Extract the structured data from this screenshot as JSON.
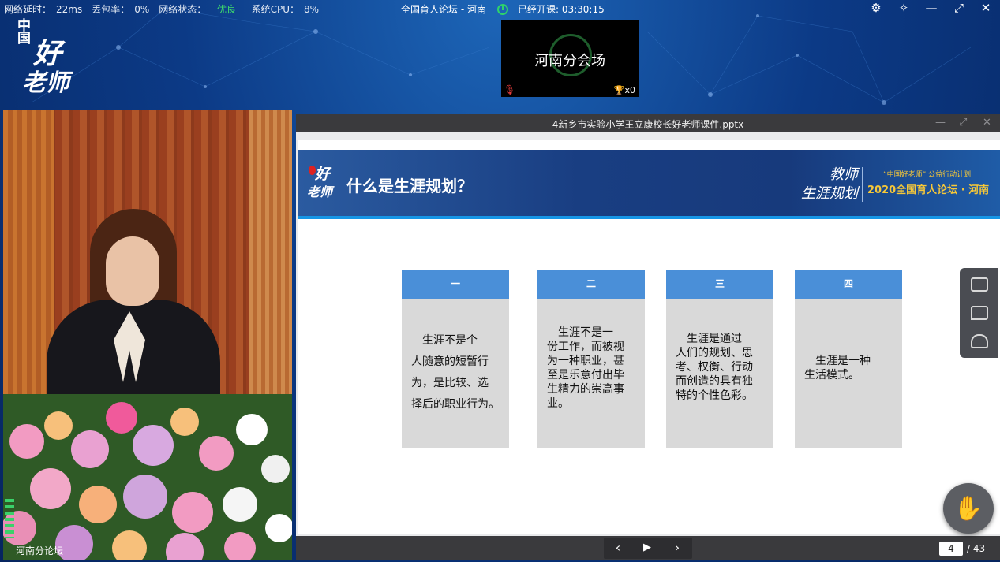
{
  "status": {
    "latency_label": "网络延时：",
    "latency_value": "22ms",
    "loss_label": "丢包率：",
    "loss_value": "0%",
    "net_label": "网络状态：",
    "net_value": "优良",
    "cpu_label": "系统CPU：",
    "cpu_value": "8%"
  },
  "header": {
    "title": "全国育人论坛 - 河南",
    "elapsed": "已经开课: 03:30:15"
  },
  "window_controls": [
    "⚙",
    "✧",
    "—",
    "⤢",
    "✕"
  ],
  "logo": {
    "line1": "中国",
    "line2": "好",
    "line3": "老师"
  },
  "venue": {
    "name": "河南分会场",
    "trophy_count": "x0"
  },
  "video": {
    "caption": "河南分论坛"
  },
  "ppt": {
    "filename": "4新乡市实验小学王立康校长好老师课件.pptx",
    "slide": {
      "logo_a": "好",
      "logo_b": "老师",
      "heading": "什么是生涯规划？",
      "brand_line1": "教师",
      "brand_line2": "生涯规划",
      "brand_sub": "“中国好老师” 公益行动计划",
      "brand_forum": "2020全国育人论坛 · 河南",
      "cards": [
        {
          "num": "一",
          "lines": [
            "　生涯不是个",
            "人随意的短暂行",
            "为，是比较、选",
            "择后的职业行为。"
          ]
        },
        {
          "num": "二",
          "lines": [
            "　生涯不是一",
            "份工作，而被视",
            "为一种职业，甚",
            "至是乐意付出毕",
            "生精力的崇高事",
            "业。"
          ]
        },
        {
          "num": "三",
          "lines": [
            "　生涯是通过",
            "人们的规划、思",
            "考、权衡、行动",
            "而创造的具有独",
            "特的个性色彩。"
          ]
        },
        {
          "num": "四",
          "lines": [
            "　生涯是一种",
            "生活模式。"
          ]
        }
      ]
    },
    "nav": {
      "prev": "‹",
      "play": "▶",
      "next": "›",
      "current_page": "4",
      "total": "/ 43"
    }
  },
  "colors": {
    "card_header": "#4a8fd8",
    "banner": "#193e82",
    "good_status": "#3fe06b"
  },
  "icons": [
    "settings-icon",
    "pin-icon",
    "minimize-icon",
    "maximize-icon",
    "close-icon",
    "clock-icon",
    "mic-muted-icon",
    "trophy-icon",
    "whiteboard-icon",
    "chat-icon",
    "members-icon",
    "raise-hand-icon"
  ]
}
